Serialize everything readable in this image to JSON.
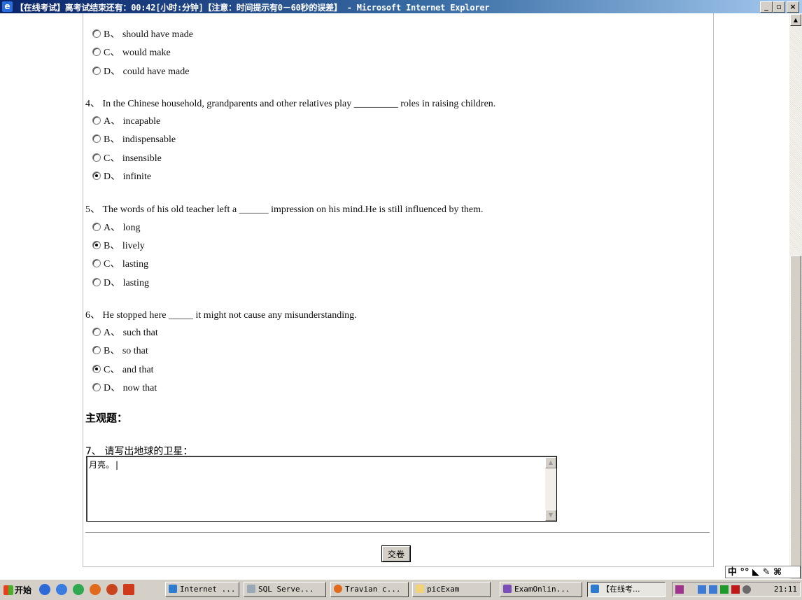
{
  "window": {
    "title": "【在线考试】离考试结束还有：00:42[小时:分钟]【注意：时间提示有0－60秒的误差】 - Microsoft Internet Explorer",
    "controls": [
      "_",
      "▫",
      "×"
    ]
  },
  "questions": {
    "q3": {
      "options": [
        {
          "label": "B、 should have made",
          "checked": false
        },
        {
          "label": "C、 would make",
          "checked": false
        },
        {
          "label": "D、 could have made",
          "checked": false
        }
      ]
    },
    "q4": {
      "text": "4、 In the Chinese household, grandparents and other relatives play _________ roles in raising children.",
      "options": [
        {
          "label": "A、 incapable",
          "checked": false
        },
        {
          "label": "B、 indispensable",
          "checked": false
        },
        {
          "label": "C、 insensible",
          "checked": false
        },
        {
          "label": "D、 infinite",
          "checked": true
        }
      ]
    },
    "q5": {
      "text": "5、 The words of his old teacher left a ______ impression on his mind.He is still influenced by them.",
      "options": [
        {
          "label": "A、 long",
          "checked": false
        },
        {
          "label": "B、 lively",
          "checked": true
        },
        {
          "label": "C、 lasting",
          "checked": false
        },
        {
          "label": "D、 lasting",
          "checked": false
        }
      ]
    },
    "q6": {
      "text": "6、 He stopped here _____ it might not cause any misunderstanding.",
      "options": [
        {
          "label": "A、 such that",
          "checked": false
        },
        {
          "label": "B、 so that",
          "checked": false
        },
        {
          "label": "C、 and that",
          "checked": true
        },
        {
          "label": "D、 now that",
          "checked": false
        }
      ]
    }
  },
  "subjective": {
    "section_title": "主观题：",
    "q7_text": "7、 请写出地球的卫星：",
    "q7_answer": "月亮。"
  },
  "submit_label": "交卷",
  "ime_label": "中 °° ◣ ✎ ⌘",
  "taskbar": {
    "start_label": "开始",
    "tasks": [
      {
        "label": "Internet ...",
        "active": false
      },
      {
        "label": "SQL Serve...",
        "active": false
      },
      {
        "label": "Travian c...",
        "active": false
      },
      {
        "label": "picExam",
        "active": false
      },
      {
        "label": "ExamOnlin...",
        "active": false
      },
      {
        "label": "【在线考...",
        "active": true
      }
    ],
    "clock": "21:11"
  },
  "colors": {
    "titlebar_start": "#0a246a",
    "titlebar_end": "#a6caf0",
    "chrome": "#d4d0c8"
  }
}
